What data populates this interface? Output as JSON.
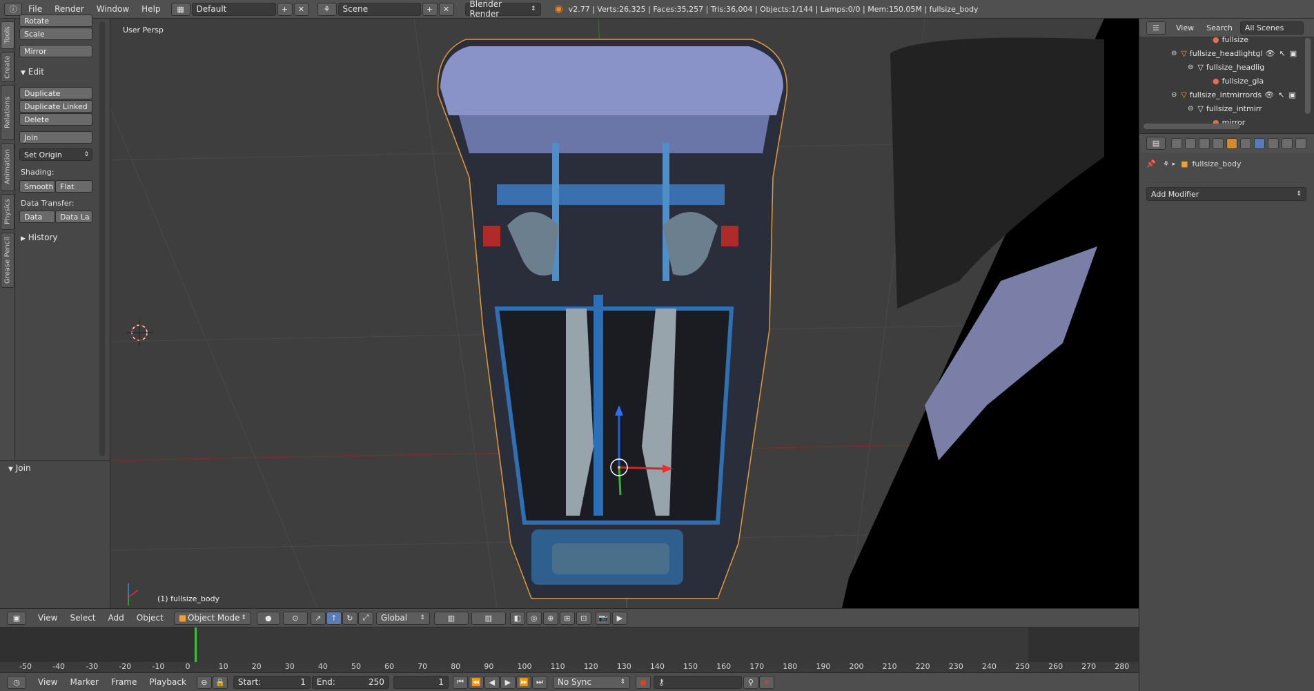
{
  "topbar": {
    "menus": [
      "File",
      "Render",
      "Window",
      "Help"
    ],
    "layout": "Default",
    "scene": "Scene",
    "engine": "Blender Render",
    "stats": "v2.77 | Verts:26,325 | Faces:35,257 | Tris:36,004 | Objects:1/144 | Lamps:0/0 | Mem:150.05M | fullsize_body"
  },
  "left_tabs": [
    "Tools",
    "Create",
    "Relations",
    "Animation",
    "Physics",
    "Grease Pencil"
  ],
  "tool_panel": {
    "top_buttons": [
      "Rotate",
      "Scale",
      "Mirror"
    ],
    "edit_header": "Edit",
    "edit_buttons": [
      "Duplicate",
      "Duplicate Linked",
      "Delete"
    ],
    "join": "Join",
    "set_origin": "Set Origin",
    "shading_label": "Shading:",
    "shading_buttons": [
      "Smooth",
      "Flat"
    ],
    "data_transfer_label": "Data Transfer:",
    "data_transfer_buttons": [
      "Data",
      "Data La"
    ],
    "history_header": "History"
  },
  "operator_panel": {
    "header": "Join"
  },
  "viewport": {
    "view_label": "User Persp",
    "object_label": "(1) fullsize_body"
  },
  "viewport_header": {
    "menus": [
      "View",
      "Select",
      "Add",
      "Object"
    ],
    "mode": "Object Mode",
    "orientation": "Global"
  },
  "timeline": {
    "ticks": [
      "-50",
      "-40",
      "-30",
      "-20",
      "-10",
      "0",
      "10",
      "20",
      "30",
      "40",
      "50",
      "60",
      "70",
      "80",
      "90",
      "100",
      "110",
      "120",
      "130",
      "140",
      "150",
      "160",
      "170",
      "180",
      "190",
      "200",
      "210",
      "220",
      "230",
      "240",
      "250",
      "260",
      "270",
      "280"
    ],
    "menus": [
      "View",
      "Marker",
      "Frame",
      "Playback"
    ],
    "start_label": "Start:",
    "start_value": "1",
    "end_label": "End:",
    "end_value": "250",
    "current_frame": "1",
    "sync": "No Sync"
  },
  "outliner": {
    "menus": [
      "View",
      "Search"
    ],
    "scenes": "All Scenes",
    "rows": [
      "fullsize",
      "fullsize_headlightgl",
      "fullsize_headlig",
      "fullsize_gla",
      "fullsize_intmirrords",
      "fullsize_intmirr",
      "mirror"
    ]
  },
  "properties": {
    "object_name": "fullsize_body",
    "add_modifier": "Add Modifier"
  }
}
